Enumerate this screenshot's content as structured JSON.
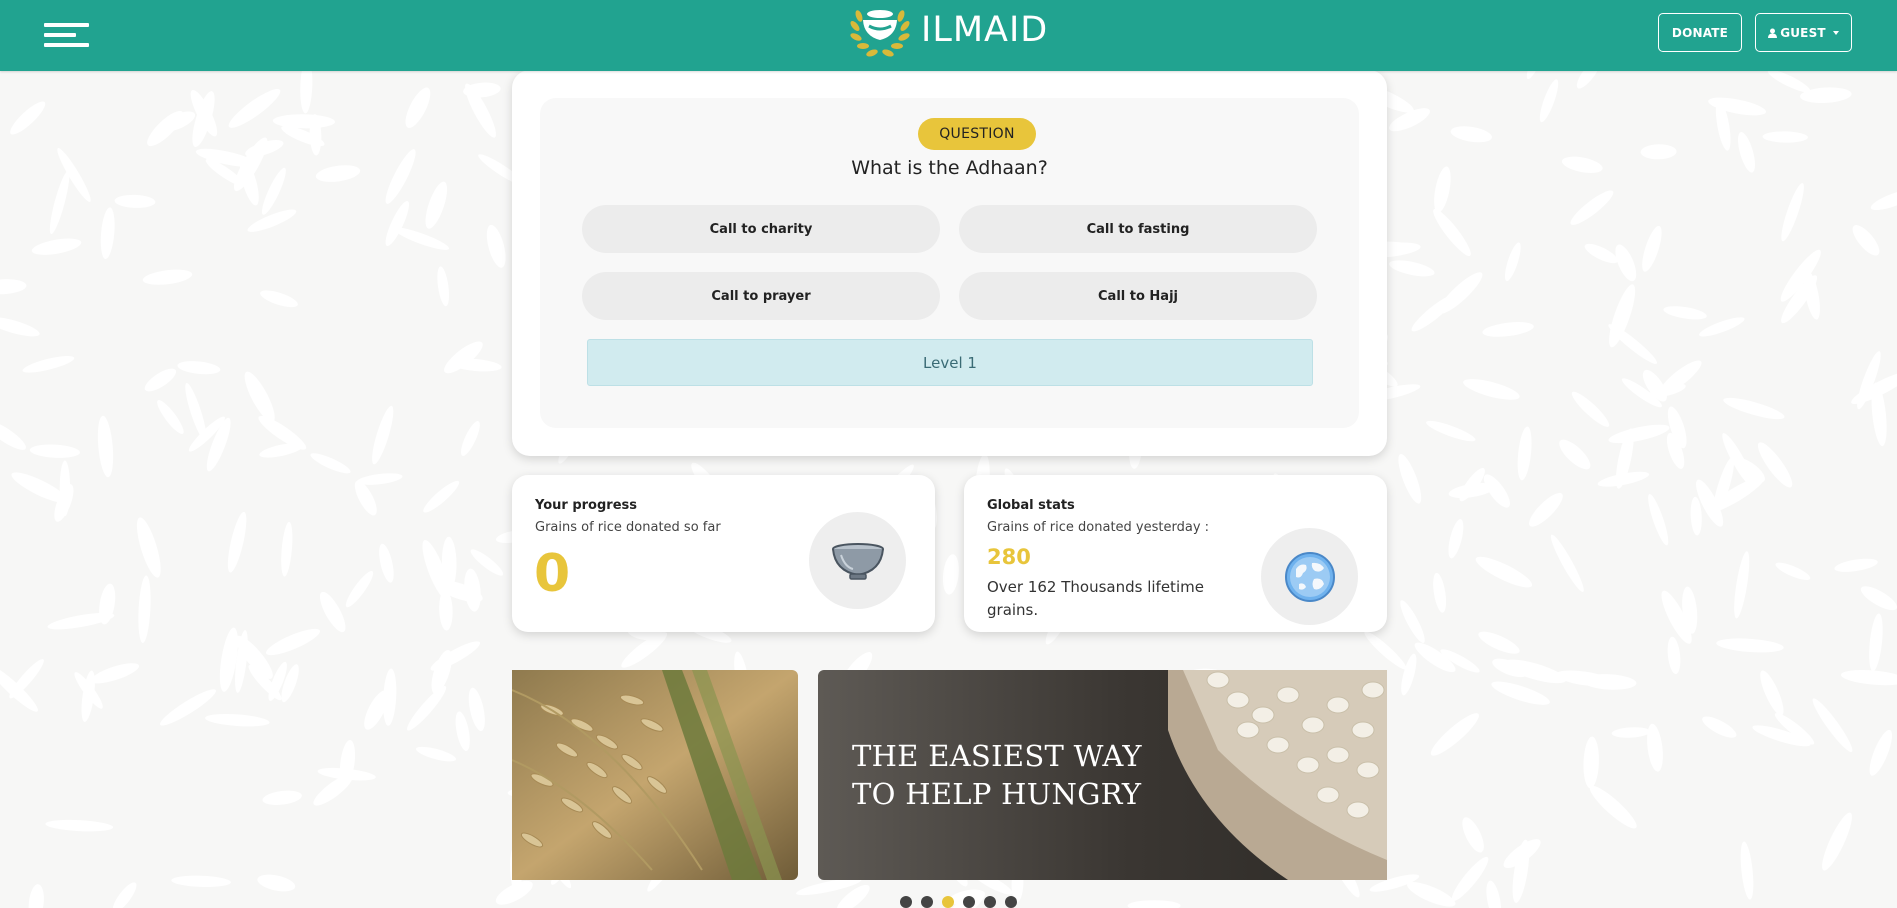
{
  "header": {
    "logo_text": "ILMAID",
    "donate_label": "DONATE",
    "guest_label": "GUEST",
    "icons": [
      "menu-icon",
      "bowl-logo-icon",
      "user-icon",
      "caret-down-icon"
    ]
  },
  "question": {
    "badge": "QUESTION",
    "text": "What is the Adhaan?",
    "answers": [
      "Call to charity",
      "Call to fasting",
      "Call to prayer",
      "Call to Hajj"
    ],
    "level": "Level 1"
  },
  "progress": {
    "title": "Your progress",
    "subtitle": "Grains of rice donated so far",
    "value": "0"
  },
  "global": {
    "title": "Global stats",
    "subtitle": "Grains of rice donated yesterday :",
    "value": "280",
    "lifetime": "Over 162 Thousands lifetime grains."
  },
  "carousel": {
    "caption_line1": "THE EASIEST WAY",
    "caption_line2": "TO HELP HUNGRY",
    "slide_count": 6,
    "active_index": 2
  },
  "colors": {
    "brand": "#21a390",
    "accent": "#e8c53b",
    "level_bg": "#d1ebef"
  }
}
